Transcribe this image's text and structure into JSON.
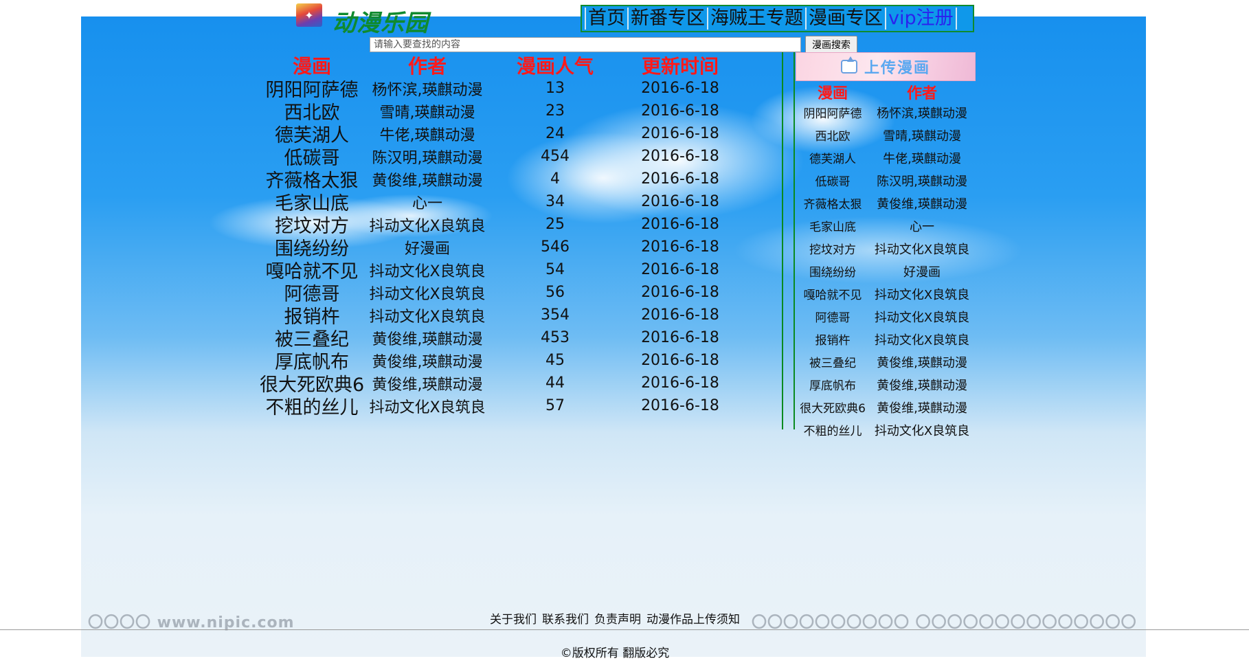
{
  "header": {
    "logo_icon": "site-logo-image",
    "logo_text": "动漫乐园",
    "nav": [
      "首页",
      "新番专区",
      "海贼王专题",
      "漫画专区",
      "vip注册"
    ]
  },
  "search": {
    "placeholder": "请输入要查找的内容",
    "value": "",
    "button_label": "漫画搜索"
  },
  "main_table": {
    "columns": [
      "漫画",
      "作者",
      "漫画人气",
      "更新时间"
    ],
    "rows": [
      [
        "阴阳阿萨德",
        "杨怀滨,瑛麒动漫",
        "13",
        "2016-6-18"
      ],
      [
        "西北欧",
        "雪晴,瑛麒动漫",
        "23",
        "2016-6-18"
      ],
      [
        "德芙湖人",
        "牛佬,瑛麒动漫",
        "24",
        "2016-6-18"
      ],
      [
        "低碳哥",
        "陈汉明,瑛麒动漫",
        "454",
        "2016-6-18"
      ],
      [
        "齐薇格太狠",
        "黄俊维,瑛麒动漫",
        "4",
        "2016-6-18"
      ],
      [
        "毛家山底",
        "心一",
        "34",
        "2016-6-18"
      ],
      [
        "挖坟对方",
        "抖动文化X良筑良",
        "25",
        "2016-6-18"
      ],
      [
        "围绕纷纷",
        "好漫画",
        "546",
        "2016-6-18"
      ],
      [
        "嘎哈就不见",
        "抖动文化X良筑良",
        "54",
        "2016-6-18"
      ],
      [
        "阿德哥",
        "抖动文化X良筑良",
        "56",
        "2016-6-18"
      ],
      [
        "报销杵",
        "抖动文化X良筑良",
        "354",
        "2016-6-18"
      ],
      [
        "被三叠纪",
        "黄俊维,瑛麒动漫",
        "453",
        "2016-6-18"
      ],
      [
        "厚底帆布",
        "黄俊维,瑛麒动漫",
        "45",
        "2016-6-18"
      ],
      [
        "很大死欧典6",
        "黄俊维,瑛麒动漫",
        "44",
        "2016-6-18"
      ],
      [
        "不粗的丝儿",
        "抖动文化X良筑良",
        "57",
        "2016-6-18"
      ]
    ]
  },
  "sidebar": {
    "upload_label": "上传漫画",
    "upload_icon": "upload-icon",
    "columns": [
      "漫画",
      "作者"
    ],
    "rows": [
      [
        "阴阳阿萨德",
        "杨怀滨,瑛麒动漫"
      ],
      [
        "西北欧",
        "雪晴,瑛麒动漫"
      ],
      [
        "德芙湖人",
        "牛佬,瑛麒动漫"
      ],
      [
        "低碳哥",
        "陈汉明,瑛麒动漫"
      ],
      [
        "齐薇格太狠",
        "黄俊维,瑛麒动漫"
      ],
      [
        "毛家山底",
        "心一"
      ],
      [
        "挖坟对方",
        "抖动文化X良筑良"
      ],
      [
        "围绕纷纷",
        "好漫画"
      ],
      [
        "嘎哈就不见",
        "抖动文化X良筑良"
      ],
      [
        "阿德哥",
        "抖动文化X良筑良"
      ],
      [
        "报销杵",
        "抖动文化X良筑良"
      ],
      [
        "被三叠纪",
        "黄俊维,瑛麒动漫"
      ],
      [
        "厚底帆布",
        "黄俊维,瑛麒动漫"
      ],
      [
        "很大死欧典6",
        "黄俊维,瑛麒动漫"
      ],
      [
        "不粗的丝儿",
        "抖动文化X良筑良"
      ]
    ]
  },
  "footer": {
    "links": [
      "关于我们",
      "联系我们",
      "负责声明",
      "动漫作品上传须知"
    ],
    "copyright": "©版权所有  翻版必究"
  },
  "colors": {
    "nav_bg": "#0f98ea",
    "logo_green": "#0f8a2e",
    "header_red": "#ff1a1a",
    "divider_green": "#0a8a20",
    "vip_blue": "#2a22ee"
  }
}
